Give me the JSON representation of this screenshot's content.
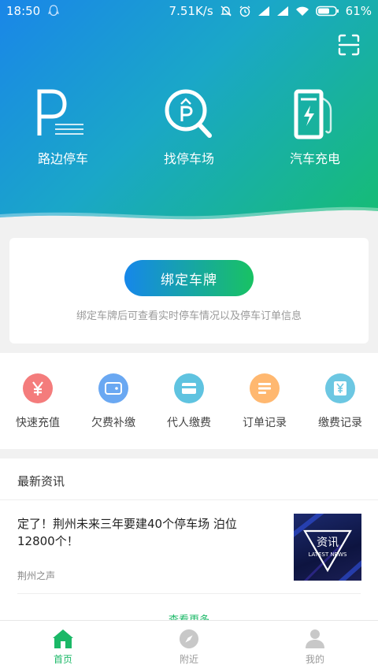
{
  "status_bar": {
    "time": "18:50",
    "network_speed": "7.51K/s",
    "battery": "61%"
  },
  "header": {
    "scan_icon": "scan-icon",
    "actions": [
      {
        "label": "路边停车",
        "icon": "roadside-parking-icon"
      },
      {
        "label": "找停车场",
        "icon": "find-parking-lot-icon"
      },
      {
        "label": "汽车充电",
        "icon": "ev-charging-icon"
      }
    ]
  },
  "bind_card": {
    "button_label": "绑定车牌",
    "hint": "绑定车牌后可查看实时停车情况以及停车订单信息"
  },
  "shortcuts": [
    {
      "label": "快速充值",
      "icon": "yuan-icon",
      "color": "#f47c7c"
    },
    {
      "label": "欠费补缴",
      "icon": "wallet-icon",
      "color": "#6aa8f2"
    },
    {
      "label": "代人缴费",
      "icon": "card-icon",
      "color": "#5fc3e0"
    },
    {
      "label": "订单记录",
      "icon": "list-icon",
      "color": "#ffb870"
    },
    {
      "label": "缴费记录",
      "icon": "receipt-icon",
      "color": "#6cc7e2"
    }
  ],
  "news": {
    "section_title": "最新资讯",
    "items": [
      {
        "title": "定了！荆州未来三年要建40个停车场 泊位12800个！",
        "source": "荆州之声",
        "thumb_title": "资讯",
        "thumb_subtitle": "LATEST NEWS"
      }
    ],
    "more_label": "查看更多"
  },
  "bottom_nav": [
    {
      "label": "首页",
      "icon": "home-icon",
      "active": true
    },
    {
      "label": "附近",
      "icon": "compass-icon",
      "active": false
    },
    {
      "label": "我的",
      "icon": "user-icon",
      "active": false
    }
  ],
  "colors": {
    "accent": "#1bb867",
    "gradient_start": "#1a86e8",
    "gradient_end": "#16bd72"
  }
}
